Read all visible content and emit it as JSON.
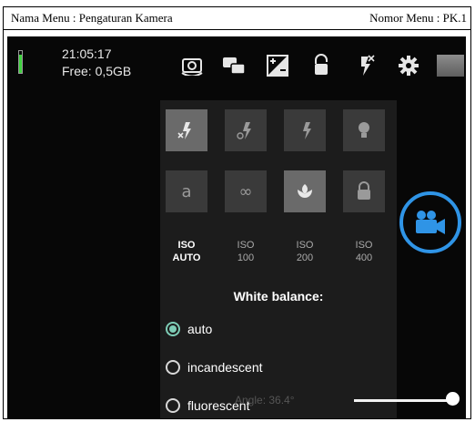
{
  "document": {
    "menu_name": "Nama Menu : Pengaturan Kamera",
    "menu_number": "Nomor Menu : PK.1"
  },
  "status": {
    "time": "21:05:17",
    "free_storage": "Free: 0,5GB",
    "battery_level": 0.85,
    "battery_color": "#3fd33f"
  },
  "toolbar": {
    "icons": [
      "switch-camera-icon",
      "multi-camera-icon",
      "exposure-icon",
      "exposure-lock-icon",
      "flash-off-icon",
      "settings-icon",
      "gallery-thumbnail"
    ]
  },
  "flash_modes": {
    "icons": [
      "flash-off-icon",
      "flash-auto-icon",
      "flash-on-icon",
      "torch-icon"
    ],
    "selected": 0
  },
  "focus_modes": {
    "labels": [
      "a",
      "∞",
      "",
      ""
    ],
    "icons": [
      "focus-auto-icon",
      "focus-infinity-icon",
      "focus-macro-icon",
      "focus-locked-icon"
    ],
    "selected": 2
  },
  "iso": {
    "options": [
      {
        "line1": "ISO",
        "line2": "AUTO"
      },
      {
        "line1": "ISO",
        "line2": "100"
      },
      {
        "line1": "ISO",
        "line2": "200"
      },
      {
        "line1": "ISO",
        "line2": "400"
      }
    ],
    "selected": 0
  },
  "white_balance": {
    "title": "White balance:",
    "options": [
      "auto",
      "incandescent",
      "fluorescent"
    ],
    "selected": 0,
    "accent_color": "#7ecdb6"
  },
  "overlay": {
    "angle_text": "Angle: 36.4°"
  },
  "record_button": {
    "icon": "video-camera-icon",
    "color": "#2f94e6"
  },
  "zoom": {
    "level": 0.98
  }
}
